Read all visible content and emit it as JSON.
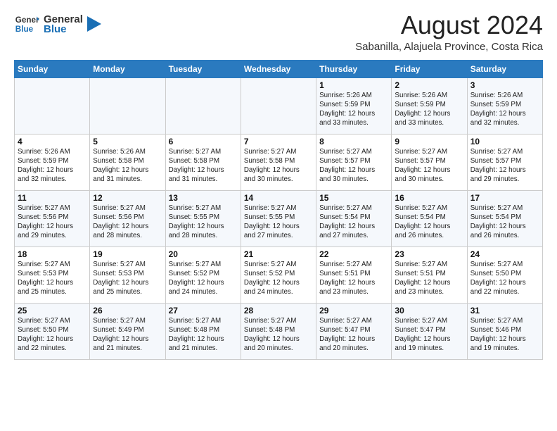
{
  "logo": {
    "text_general": "General",
    "text_blue": "Blue"
  },
  "header": {
    "month_year": "August 2024",
    "location": "Sabanilla, Alajuela Province, Costa Rica"
  },
  "days_of_week": [
    "Sunday",
    "Monday",
    "Tuesday",
    "Wednesday",
    "Thursday",
    "Friday",
    "Saturday"
  ],
  "weeks": [
    [
      {
        "day": "",
        "info": ""
      },
      {
        "day": "",
        "info": ""
      },
      {
        "day": "",
        "info": ""
      },
      {
        "day": "",
        "info": ""
      },
      {
        "day": "1",
        "info": "Sunrise: 5:26 AM\nSunset: 5:59 PM\nDaylight: 12 hours\nand 33 minutes."
      },
      {
        "day": "2",
        "info": "Sunrise: 5:26 AM\nSunset: 5:59 PM\nDaylight: 12 hours\nand 33 minutes."
      },
      {
        "day": "3",
        "info": "Sunrise: 5:26 AM\nSunset: 5:59 PM\nDaylight: 12 hours\nand 32 minutes."
      }
    ],
    [
      {
        "day": "4",
        "info": "Sunrise: 5:26 AM\nSunset: 5:59 PM\nDaylight: 12 hours\nand 32 minutes."
      },
      {
        "day": "5",
        "info": "Sunrise: 5:26 AM\nSunset: 5:58 PM\nDaylight: 12 hours\nand 31 minutes."
      },
      {
        "day": "6",
        "info": "Sunrise: 5:27 AM\nSunset: 5:58 PM\nDaylight: 12 hours\nand 31 minutes."
      },
      {
        "day": "7",
        "info": "Sunrise: 5:27 AM\nSunset: 5:58 PM\nDaylight: 12 hours\nand 30 minutes."
      },
      {
        "day": "8",
        "info": "Sunrise: 5:27 AM\nSunset: 5:57 PM\nDaylight: 12 hours\nand 30 minutes."
      },
      {
        "day": "9",
        "info": "Sunrise: 5:27 AM\nSunset: 5:57 PM\nDaylight: 12 hours\nand 30 minutes."
      },
      {
        "day": "10",
        "info": "Sunrise: 5:27 AM\nSunset: 5:57 PM\nDaylight: 12 hours\nand 29 minutes."
      }
    ],
    [
      {
        "day": "11",
        "info": "Sunrise: 5:27 AM\nSunset: 5:56 PM\nDaylight: 12 hours\nand 29 minutes."
      },
      {
        "day": "12",
        "info": "Sunrise: 5:27 AM\nSunset: 5:56 PM\nDaylight: 12 hours\nand 28 minutes."
      },
      {
        "day": "13",
        "info": "Sunrise: 5:27 AM\nSunset: 5:55 PM\nDaylight: 12 hours\nand 28 minutes."
      },
      {
        "day": "14",
        "info": "Sunrise: 5:27 AM\nSunset: 5:55 PM\nDaylight: 12 hours\nand 27 minutes."
      },
      {
        "day": "15",
        "info": "Sunrise: 5:27 AM\nSunset: 5:54 PM\nDaylight: 12 hours\nand 27 minutes."
      },
      {
        "day": "16",
        "info": "Sunrise: 5:27 AM\nSunset: 5:54 PM\nDaylight: 12 hours\nand 26 minutes."
      },
      {
        "day": "17",
        "info": "Sunrise: 5:27 AM\nSunset: 5:54 PM\nDaylight: 12 hours\nand 26 minutes."
      }
    ],
    [
      {
        "day": "18",
        "info": "Sunrise: 5:27 AM\nSunset: 5:53 PM\nDaylight: 12 hours\nand 25 minutes."
      },
      {
        "day": "19",
        "info": "Sunrise: 5:27 AM\nSunset: 5:53 PM\nDaylight: 12 hours\nand 25 minutes."
      },
      {
        "day": "20",
        "info": "Sunrise: 5:27 AM\nSunset: 5:52 PM\nDaylight: 12 hours\nand 24 minutes."
      },
      {
        "day": "21",
        "info": "Sunrise: 5:27 AM\nSunset: 5:52 PM\nDaylight: 12 hours\nand 24 minutes."
      },
      {
        "day": "22",
        "info": "Sunrise: 5:27 AM\nSunset: 5:51 PM\nDaylight: 12 hours\nand 23 minutes."
      },
      {
        "day": "23",
        "info": "Sunrise: 5:27 AM\nSunset: 5:51 PM\nDaylight: 12 hours\nand 23 minutes."
      },
      {
        "day": "24",
        "info": "Sunrise: 5:27 AM\nSunset: 5:50 PM\nDaylight: 12 hours\nand 22 minutes."
      }
    ],
    [
      {
        "day": "25",
        "info": "Sunrise: 5:27 AM\nSunset: 5:50 PM\nDaylight: 12 hours\nand 22 minutes."
      },
      {
        "day": "26",
        "info": "Sunrise: 5:27 AM\nSunset: 5:49 PM\nDaylight: 12 hours\nand 21 minutes."
      },
      {
        "day": "27",
        "info": "Sunrise: 5:27 AM\nSunset: 5:48 PM\nDaylight: 12 hours\nand 21 minutes."
      },
      {
        "day": "28",
        "info": "Sunrise: 5:27 AM\nSunset: 5:48 PM\nDaylight: 12 hours\nand 20 minutes."
      },
      {
        "day": "29",
        "info": "Sunrise: 5:27 AM\nSunset: 5:47 PM\nDaylight: 12 hours\nand 20 minutes."
      },
      {
        "day": "30",
        "info": "Sunrise: 5:27 AM\nSunset: 5:47 PM\nDaylight: 12 hours\nand 19 minutes."
      },
      {
        "day": "31",
        "info": "Sunrise: 5:27 AM\nSunset: 5:46 PM\nDaylight: 12 hours\nand 19 minutes."
      }
    ]
  ]
}
